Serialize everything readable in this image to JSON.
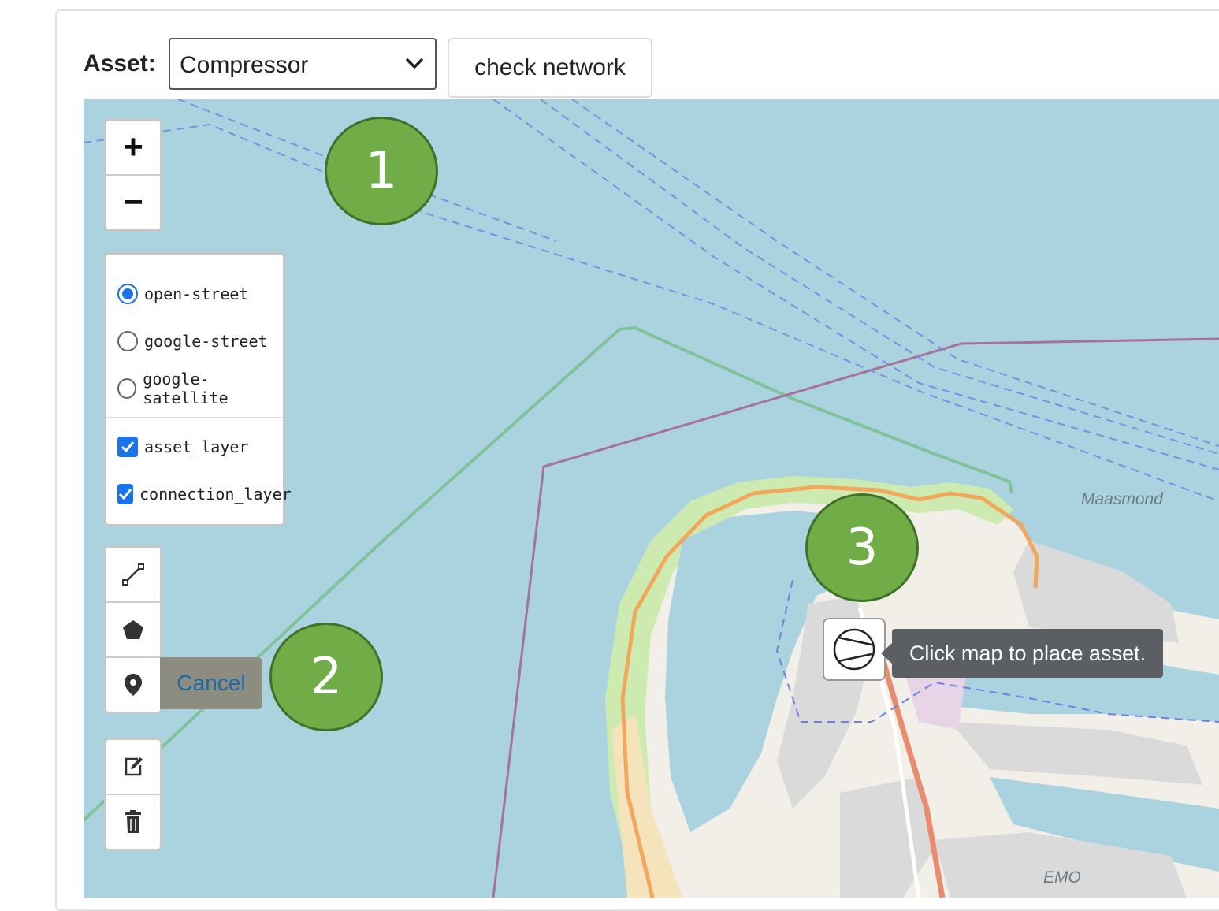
{
  "toolbar": {
    "asset_label": "Asset:",
    "asset_selected": "Compressor",
    "check_network_label": "check network"
  },
  "map": {
    "zoom_in": "+",
    "zoom_out": "−",
    "base_layers": [
      {
        "label": "open-street",
        "selected": true
      },
      {
        "label": "google-street",
        "selected": false
      },
      {
        "label": "google-satellite",
        "selected": false
      }
    ],
    "overlays": [
      {
        "label": "asset_layer",
        "checked": true
      },
      {
        "label": "connection_layer",
        "checked": true
      }
    ],
    "draw_tools": [
      "polyline-icon",
      "polygon-icon",
      "marker-icon"
    ],
    "edit_tools": [
      "edit-icon",
      "trash-icon"
    ],
    "cancel_label": "Cancel",
    "tooltip": "Click map to place asset.",
    "place_labels": {
      "maasmond": "Maasmond",
      "emo": "EMO"
    },
    "colors": {
      "water": "#aad3df",
      "land": "#f2efe9",
      "green": "#cdebb0",
      "industrial": "#dadada",
      "road": "#f2a85c",
      "accent": "#1a73e8"
    }
  },
  "annotations": [
    {
      "number": "1"
    },
    {
      "number": "2"
    },
    {
      "number": "3"
    }
  ]
}
